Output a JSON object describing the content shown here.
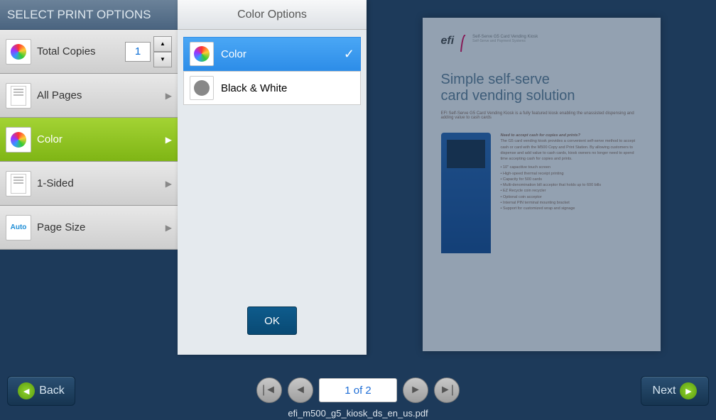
{
  "panel": {
    "title": "SELECT PRINT OPTIONS",
    "copies_label": "Total Copies",
    "copies_value": "1",
    "options": [
      {
        "label": "All Pages"
      },
      {
        "label": "Color",
        "selected": true
      },
      {
        "label": "1-Sided"
      },
      {
        "label": "Page Size"
      }
    ]
  },
  "submenu": {
    "title": "Color Options",
    "items": [
      {
        "label": "Color",
        "selected": true
      },
      {
        "label": "Black & White"
      }
    ],
    "ok_label": "OK"
  },
  "preview": {
    "logo_text": "efi",
    "logo_sub": "Self-Serve G5 Card Vending Kiosk",
    "title_line1": "Simple self-serve",
    "title_line2": "card vending solution",
    "intro": "EFI Self-Serve G5 Card Vending Kiosk is a fully featured kiosk enabling the unassisted dispensing and adding value to cash cards",
    "side_heading": "Need to accept cash for copies and prints?",
    "side_body": "The G5 card vending kiosk provides a convenient self-serve method to accept cash or card with the M500 Copy and Print Station. By allowing customers to dispense and add value to cash cards, kiosk owners no longer need to spend time accepting cash for copies and prints.",
    "bullets": [
      "10\" capacitive touch screen",
      "High-speed thermal receipt printing",
      "Capacity for 500 cards",
      "Multi-denomination bill acceptor that holds up to 600 bills",
      "EZ Recycle coin recycler",
      "Optional coin acceptor",
      "Internal PIN terminal mounting bracket",
      "Support for customized wrap and signage"
    ]
  },
  "pager": {
    "display": "1 of 2"
  },
  "filename": "efi_m500_g5_kiosk_ds_en_us.pdf",
  "nav": {
    "back": "Back",
    "next": "Next"
  }
}
